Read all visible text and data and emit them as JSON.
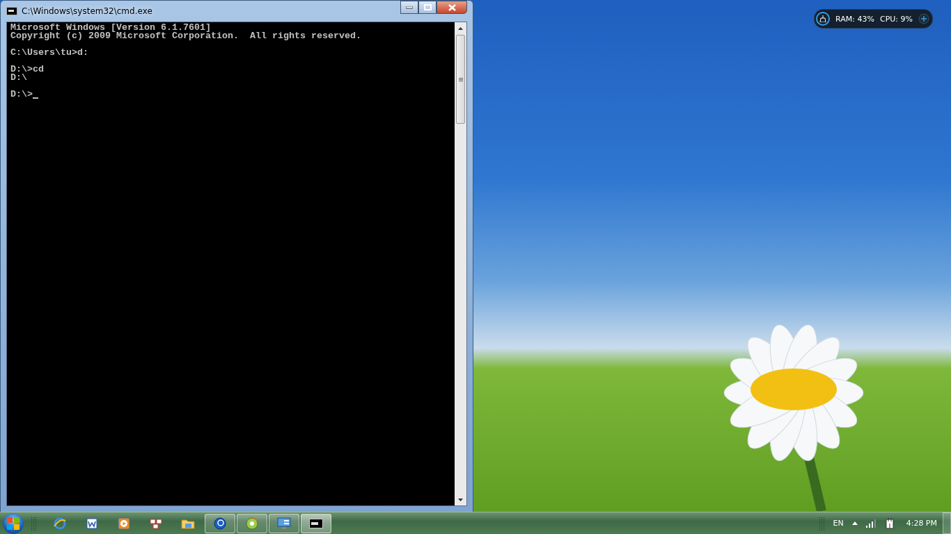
{
  "window": {
    "title": "C:\\Windows\\system32\\cmd.exe"
  },
  "console": {
    "blocks": [
      [
        "Microsoft Windows [Version 6.1.7601]",
        "Copyright (c) 2009 Microsoft Corporation.  All rights reserved."
      ],
      [
        "C:\\Users\\tu>d:"
      ],
      [
        "D:\\>cd",
        "D:\\"
      ],
      [
        "D:\\>"
      ]
    ]
  },
  "gadget": {
    "ram": "RAM: 43%",
    "cpu": "CPU: 9%"
  },
  "taskbar": {
    "items": [
      {
        "kind": "ie",
        "running": false,
        "selected": false
      },
      {
        "kind": "word",
        "running": false,
        "selected": false
      },
      {
        "kind": "media",
        "running": false,
        "selected": false
      },
      {
        "kind": "tiles",
        "running": false,
        "selected": false
      },
      {
        "kind": "folder",
        "running": false,
        "selected": false
      },
      {
        "kind": "globe",
        "running": true,
        "selected": false
      },
      {
        "kind": "disc",
        "running": true,
        "selected": false
      },
      {
        "kind": "monitor",
        "running": true,
        "selected": false
      },
      {
        "kind": "cmd",
        "running": true,
        "selected": true
      }
    ],
    "language": "EN",
    "clock": "4:28 PM"
  }
}
